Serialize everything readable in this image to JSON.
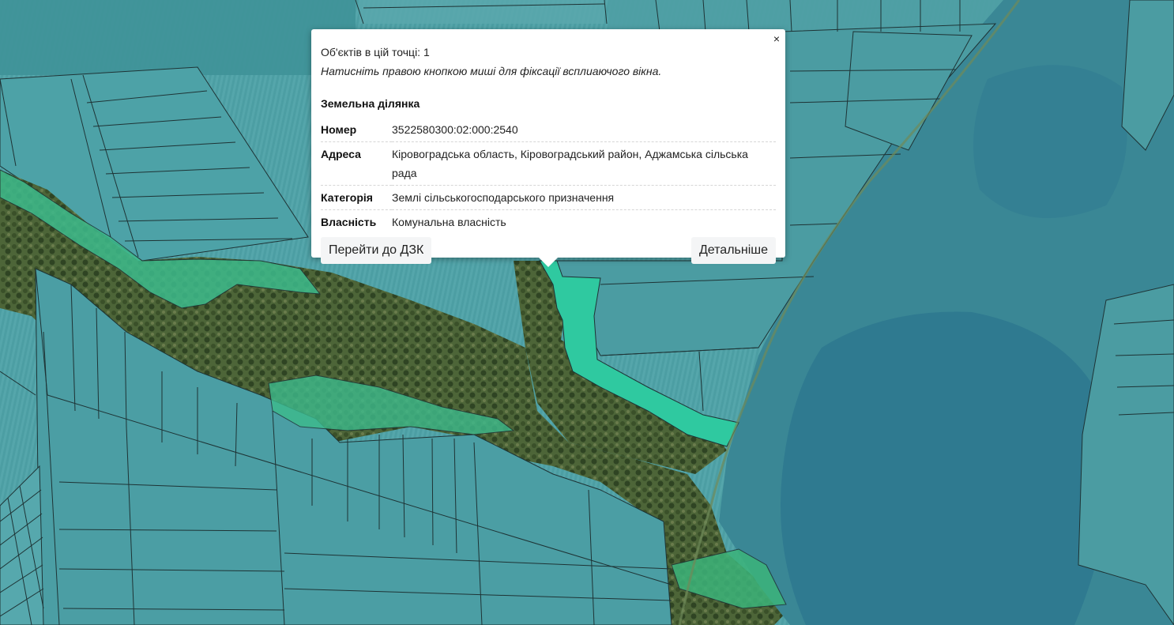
{
  "map": {
    "colors": {
      "parcel_fill": "#3f9aa0",
      "parcel_line": "#20393a",
      "forest": "#3f5a2f",
      "selected_parcel": "#2fc49c",
      "green_parcel": "#3fb883",
      "water": "#2f7f94",
      "field_light": "#6fb3b5"
    }
  },
  "popup": {
    "close_label": "×",
    "objects_count_text": "Об'єктів в цій точці: 1",
    "hint_text": "Натисніть правою кнопкою миші для фіксації всплиаючого вікна.",
    "section_title": "Земельна ділянка",
    "attributes": [
      {
        "key": "Номер",
        "value": "3522580300:02:000:2540"
      },
      {
        "key": "Адреса",
        "value": "Кіровоградська область, Кіровоградський район, Аджамська сільська рада"
      },
      {
        "key": "Категорія",
        "value": "Землі сільськогосподарського призначення"
      },
      {
        "key": "Власність",
        "value": "Комунальна власність"
      }
    ],
    "btn_dzk": "Перейти до ДЗК",
    "btn_details": "Детальніше"
  }
}
